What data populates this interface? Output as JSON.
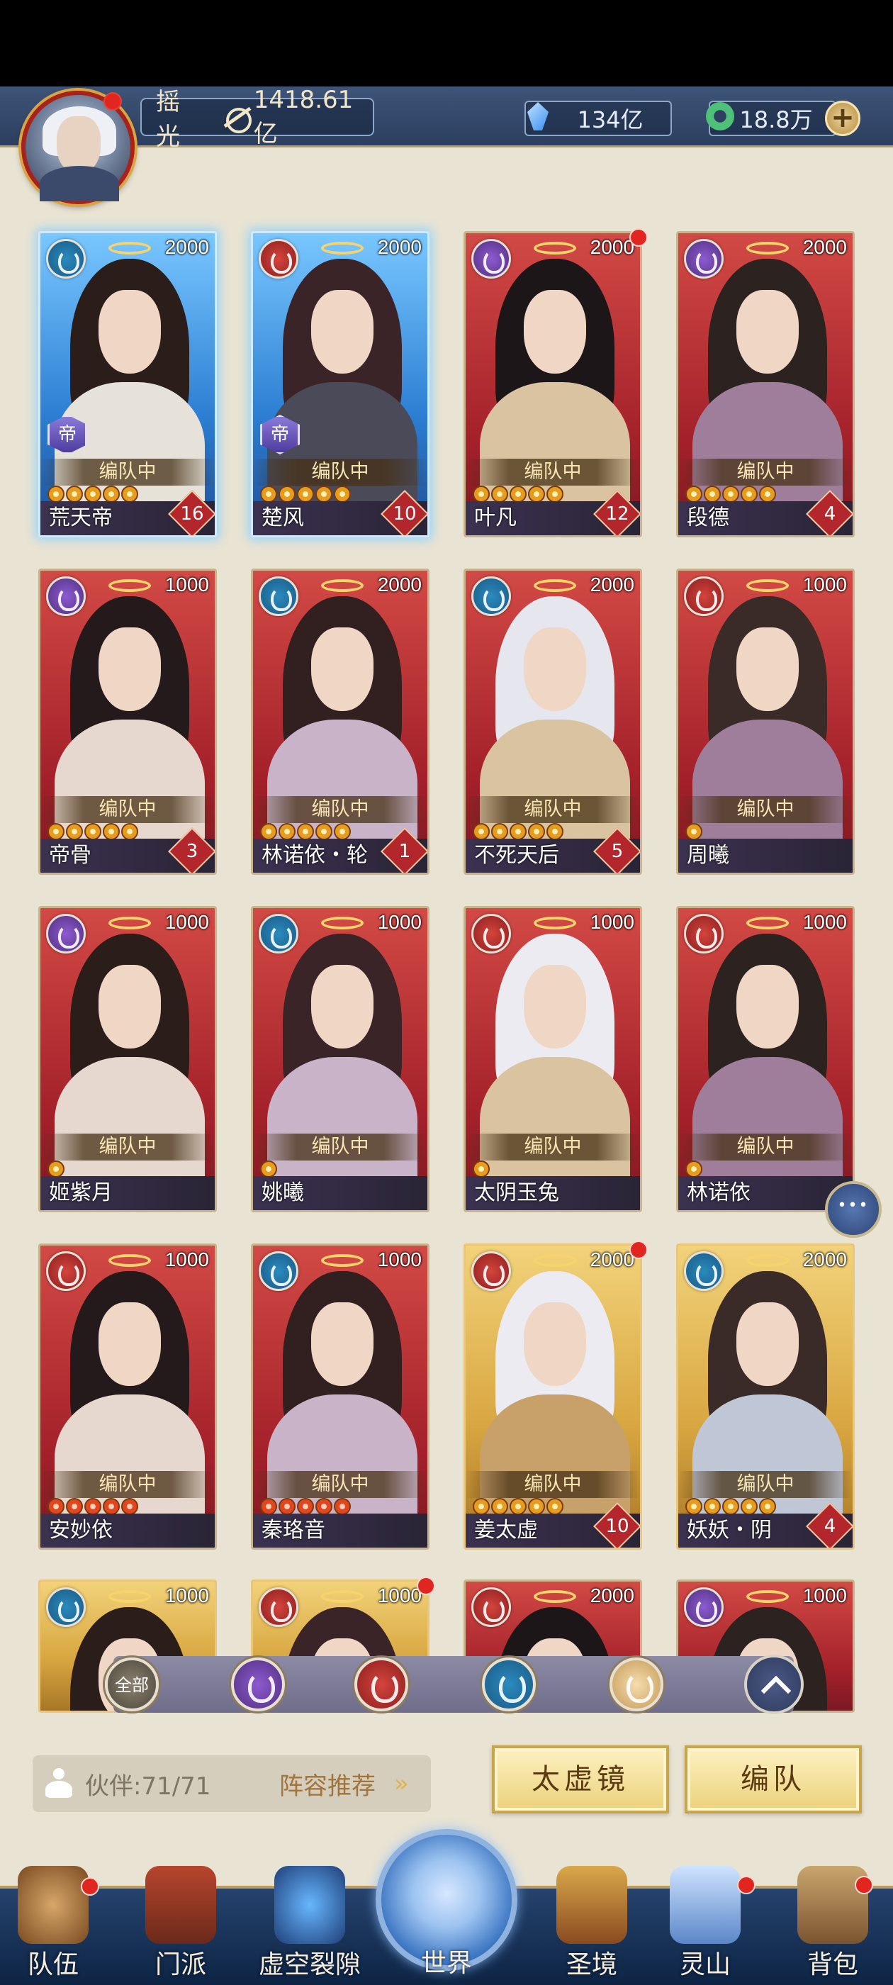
{
  "header": {
    "player_name": "摇光",
    "power": "1418.61亿",
    "crystals": "134亿",
    "jade": "18.8万",
    "add_label": "+"
  },
  "cards": [
    {
      "name": "荒天帝",
      "cost": "2000",
      "element": "wind",
      "frame": "blue",
      "status": "编队中",
      "stars": 5,
      "level": "16",
      "emperor": "帝",
      "red_dot": false
    },
    {
      "name": "楚风",
      "cost": "2000",
      "element": "fire",
      "frame": "blue",
      "status": "编队中",
      "stars": 5,
      "level": "10",
      "emperor": "帝",
      "red_dot": false
    },
    {
      "name": "叶凡",
      "cost": "2000",
      "element": "void",
      "frame": "red",
      "status": "编队中",
      "stars": 5,
      "level": "12",
      "emperor": "",
      "red_dot": true
    },
    {
      "name": "段德",
      "cost": "2000",
      "element": "void",
      "frame": "red",
      "status": "编队中",
      "stars": 5,
      "level": "4",
      "emperor": "",
      "red_dot": false
    },
    {
      "name": "帝骨",
      "cost": "1000",
      "element": "void",
      "frame": "red",
      "status": "编队中",
      "stars": 5,
      "level": "3",
      "emperor": "",
      "red_dot": false
    },
    {
      "name": "林诺依・轮",
      "cost": "2000",
      "element": "wind",
      "frame": "red",
      "status": "编队中",
      "stars": 5,
      "level": "1",
      "emperor": "",
      "red_dot": false
    },
    {
      "name": "不死天后",
      "cost": "2000",
      "element": "wind",
      "frame": "red",
      "status": "编队中",
      "stars": 5,
      "level": "5",
      "emperor": "",
      "red_dot": false
    },
    {
      "name": "周曦",
      "cost": "1000",
      "element": "fire",
      "frame": "red",
      "status": "编队中",
      "stars": 1,
      "level": "",
      "emperor": "",
      "red_dot": false
    },
    {
      "name": "姬紫月",
      "cost": "1000",
      "element": "void",
      "frame": "red",
      "status": "编队中",
      "stars": 1,
      "level": "",
      "emperor": "",
      "red_dot": false
    },
    {
      "name": "姚曦",
      "cost": "1000",
      "element": "wind",
      "frame": "red",
      "status": "编队中",
      "stars": 1,
      "level": "",
      "emperor": "",
      "red_dot": false
    },
    {
      "name": "太阴玉兔",
      "cost": "1000",
      "element": "fire",
      "frame": "red",
      "status": "编队中",
      "stars": 1,
      "level": "",
      "emperor": "",
      "red_dot": false
    },
    {
      "name": "林诺依",
      "cost": "1000",
      "element": "fire",
      "frame": "red",
      "status": "编队中",
      "stars": 1,
      "level": "",
      "emperor": "",
      "red_dot": false
    },
    {
      "name": "安妙依",
      "cost": "1000",
      "element": "fire",
      "frame": "red",
      "status": "编队中",
      "stars": 5,
      "level": "",
      "emperor": "",
      "red_dot": false,
      "star_style": "red"
    },
    {
      "name": "秦珞音",
      "cost": "1000",
      "element": "wind",
      "frame": "red",
      "status": "编队中",
      "stars": 5,
      "level": "",
      "emperor": "",
      "red_dot": false,
      "star_style": "red"
    },
    {
      "name": "姜太虚",
      "cost": "2000",
      "element": "fire",
      "frame": "gold",
      "status": "编队中",
      "stars": 5,
      "level": "10",
      "emperor": "",
      "red_dot": true
    },
    {
      "name": "妖妖・阴",
      "cost": "2000",
      "element": "wind",
      "frame": "gold",
      "status": "编队中",
      "stars": 5,
      "level": "4",
      "emperor": "",
      "red_dot": false
    },
    {
      "name": "",
      "cost": "1000",
      "element": "wind",
      "frame": "gold",
      "status": "",
      "stars": 0,
      "level": "",
      "emperor": "",
      "red_dot": false
    },
    {
      "name": "",
      "cost": "1000",
      "element": "fire",
      "frame": "gold",
      "status": "",
      "stars": 0,
      "level": "",
      "emperor": "",
      "red_dot": true
    },
    {
      "name": "",
      "cost": "2000",
      "element": "fire",
      "frame": "red",
      "status": "",
      "stars": 0,
      "level": "",
      "emperor": "",
      "red_dot": false
    },
    {
      "name": "",
      "cost": "1000",
      "element": "void",
      "frame": "red",
      "status": "",
      "stars": 0,
      "level": "",
      "emperor": "",
      "red_dot": false
    }
  ],
  "filters": {
    "all_label": "全部",
    "items": [
      "all",
      "void",
      "fire",
      "wind",
      "light"
    ]
  },
  "footer": {
    "partner_label": "伙伴:71/71",
    "recommend_label": "阵容推荐",
    "recommend_arrow": "»",
    "mirror_button": "太虚镜",
    "formation_button": "编队"
  },
  "nav": {
    "team": "队伍",
    "sect": "门派",
    "rift": "虚空裂隙",
    "world": "世界",
    "holy": "圣境",
    "spirit": "灵山",
    "bag": "背包"
  },
  "colors": {
    "top_bar": "#2c3f60",
    "nav_bar": "#0d2444",
    "accent_gold": "#e9c679",
    "card_red": "#a3202a",
    "card_blue": "#2d7fd3"
  },
  "icons": [
    "power-icon",
    "crystal-icon",
    "jade-icon",
    "plus-icon",
    "chat-icon",
    "chevron-up-icon",
    "partner-icon"
  ]
}
